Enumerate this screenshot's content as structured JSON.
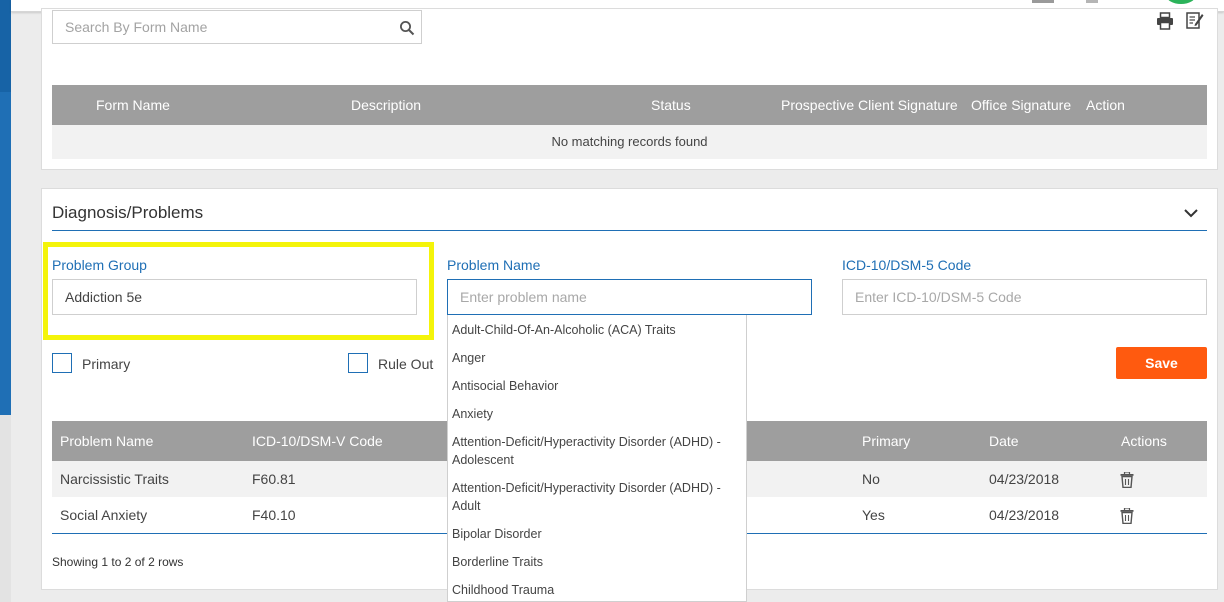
{
  "forms": {
    "search_placeholder": "Search By Form Name",
    "columns": [
      "Form Name",
      "Description",
      "Status",
      "Prospective Client Signature",
      "Office Signature",
      "Action"
    ],
    "empty_message": "No matching records found"
  },
  "diagnosis": {
    "title": "Diagnosis/Problems",
    "problem_group_label": "Problem Group",
    "problem_group_value": "Addiction 5e",
    "problem_name_label": "Problem Name",
    "problem_name_placeholder": "Enter problem name",
    "icd_label": "ICD-10/DSM-5 Code",
    "icd_placeholder": "Enter ICD-10/DSM-5 Code",
    "primary_label": "Primary",
    "rule_out_label": "Rule Out",
    "save_label": "Save",
    "table": {
      "columns": [
        "Problem Name",
        "ICD-10/DSM-V Code",
        "Primary",
        "Date",
        "Actions"
      ],
      "rows": [
        {
          "name": "Narcissistic Traits",
          "code": "F60.81",
          "primary": "No",
          "date": "04/23/2018"
        },
        {
          "name": "Social Anxiety",
          "code": "F40.10",
          "primary": "Yes",
          "date": "04/23/2018"
        }
      ]
    },
    "showing_text": "Showing 1 to 2 of 2 rows"
  },
  "dropdown": {
    "items": [
      {
        "line1": "Adult-Child-Of-An-Alcoholic (ACA) Traits",
        "line2": ""
      },
      {
        "line1": "Anger",
        "line2": ""
      },
      {
        "line1": "Antisocial Behavior",
        "line2": ""
      },
      {
        "line1": "Anxiety",
        "line2": ""
      },
      {
        "line1": "Attention-Deficit/Hyperactivity Disorder (ADHD) -",
        "line2": "Adolescent"
      },
      {
        "line1": "Attention-Deficit/Hyperactivity Disorder (ADHD) -",
        "line2": "Adult"
      },
      {
        "line1": "Bipolar Disorder",
        "line2": ""
      },
      {
        "line1": "Borderline Traits",
        "line2": ""
      },
      {
        "line1": "Childhood Trauma",
        "line2": ""
      }
    ]
  },
  "colors": {
    "accent": "#1f6fb5",
    "save_button": "#ff5a0f",
    "highlight": "#f4f40a",
    "table_header": "#9e9e9e"
  },
  "icons": [
    "search-icon",
    "print-icon",
    "edit-icon",
    "chevron-down-icon",
    "trash-icon"
  ]
}
